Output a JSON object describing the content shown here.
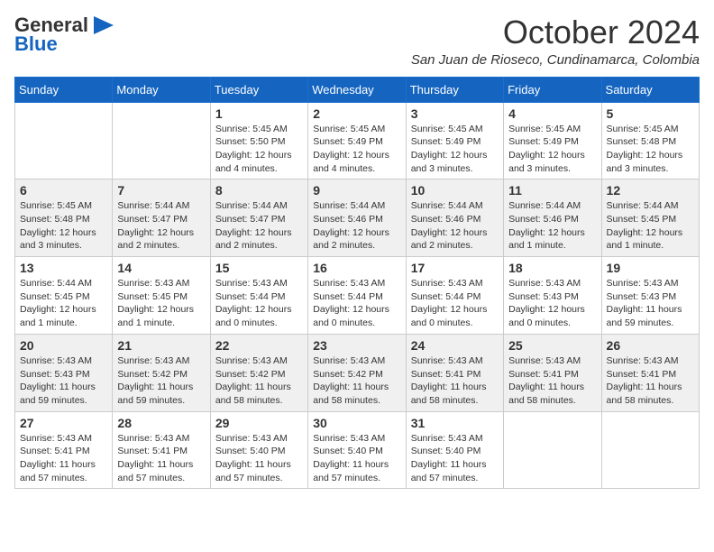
{
  "header": {
    "logo_general": "General",
    "logo_blue": "Blue",
    "month_title": "October 2024",
    "location": "San Juan de Rioseco, Cundinamarca, Colombia"
  },
  "days_of_week": [
    "Sunday",
    "Monday",
    "Tuesday",
    "Wednesday",
    "Thursday",
    "Friday",
    "Saturday"
  ],
  "weeks": [
    [
      {
        "day": "",
        "info": ""
      },
      {
        "day": "",
        "info": ""
      },
      {
        "day": "1",
        "info": "Sunrise: 5:45 AM\nSunset: 5:50 PM\nDaylight: 12 hours and 4 minutes."
      },
      {
        "day": "2",
        "info": "Sunrise: 5:45 AM\nSunset: 5:49 PM\nDaylight: 12 hours and 4 minutes."
      },
      {
        "day": "3",
        "info": "Sunrise: 5:45 AM\nSunset: 5:49 PM\nDaylight: 12 hours and 3 minutes."
      },
      {
        "day": "4",
        "info": "Sunrise: 5:45 AM\nSunset: 5:49 PM\nDaylight: 12 hours and 3 minutes."
      },
      {
        "day": "5",
        "info": "Sunrise: 5:45 AM\nSunset: 5:48 PM\nDaylight: 12 hours and 3 minutes."
      }
    ],
    [
      {
        "day": "6",
        "info": "Sunrise: 5:45 AM\nSunset: 5:48 PM\nDaylight: 12 hours and 3 minutes."
      },
      {
        "day": "7",
        "info": "Sunrise: 5:44 AM\nSunset: 5:47 PM\nDaylight: 12 hours and 2 minutes."
      },
      {
        "day": "8",
        "info": "Sunrise: 5:44 AM\nSunset: 5:47 PM\nDaylight: 12 hours and 2 minutes."
      },
      {
        "day": "9",
        "info": "Sunrise: 5:44 AM\nSunset: 5:46 PM\nDaylight: 12 hours and 2 minutes."
      },
      {
        "day": "10",
        "info": "Sunrise: 5:44 AM\nSunset: 5:46 PM\nDaylight: 12 hours and 2 minutes."
      },
      {
        "day": "11",
        "info": "Sunrise: 5:44 AM\nSunset: 5:46 PM\nDaylight: 12 hours and 1 minute."
      },
      {
        "day": "12",
        "info": "Sunrise: 5:44 AM\nSunset: 5:45 PM\nDaylight: 12 hours and 1 minute."
      }
    ],
    [
      {
        "day": "13",
        "info": "Sunrise: 5:44 AM\nSunset: 5:45 PM\nDaylight: 12 hours and 1 minute."
      },
      {
        "day": "14",
        "info": "Sunrise: 5:43 AM\nSunset: 5:45 PM\nDaylight: 12 hours and 1 minute."
      },
      {
        "day": "15",
        "info": "Sunrise: 5:43 AM\nSunset: 5:44 PM\nDaylight: 12 hours and 0 minutes."
      },
      {
        "day": "16",
        "info": "Sunrise: 5:43 AM\nSunset: 5:44 PM\nDaylight: 12 hours and 0 minutes."
      },
      {
        "day": "17",
        "info": "Sunrise: 5:43 AM\nSunset: 5:44 PM\nDaylight: 12 hours and 0 minutes."
      },
      {
        "day": "18",
        "info": "Sunrise: 5:43 AM\nSunset: 5:43 PM\nDaylight: 12 hours and 0 minutes."
      },
      {
        "day": "19",
        "info": "Sunrise: 5:43 AM\nSunset: 5:43 PM\nDaylight: 11 hours and 59 minutes."
      }
    ],
    [
      {
        "day": "20",
        "info": "Sunrise: 5:43 AM\nSunset: 5:43 PM\nDaylight: 11 hours and 59 minutes."
      },
      {
        "day": "21",
        "info": "Sunrise: 5:43 AM\nSunset: 5:42 PM\nDaylight: 11 hours and 59 minutes."
      },
      {
        "day": "22",
        "info": "Sunrise: 5:43 AM\nSunset: 5:42 PM\nDaylight: 11 hours and 58 minutes."
      },
      {
        "day": "23",
        "info": "Sunrise: 5:43 AM\nSunset: 5:42 PM\nDaylight: 11 hours and 58 minutes."
      },
      {
        "day": "24",
        "info": "Sunrise: 5:43 AM\nSunset: 5:41 PM\nDaylight: 11 hours and 58 minutes."
      },
      {
        "day": "25",
        "info": "Sunrise: 5:43 AM\nSunset: 5:41 PM\nDaylight: 11 hours and 58 minutes."
      },
      {
        "day": "26",
        "info": "Sunrise: 5:43 AM\nSunset: 5:41 PM\nDaylight: 11 hours and 58 minutes."
      }
    ],
    [
      {
        "day": "27",
        "info": "Sunrise: 5:43 AM\nSunset: 5:41 PM\nDaylight: 11 hours and 57 minutes."
      },
      {
        "day": "28",
        "info": "Sunrise: 5:43 AM\nSunset: 5:41 PM\nDaylight: 11 hours and 57 minutes."
      },
      {
        "day": "29",
        "info": "Sunrise: 5:43 AM\nSunset: 5:40 PM\nDaylight: 11 hours and 57 minutes."
      },
      {
        "day": "30",
        "info": "Sunrise: 5:43 AM\nSunset: 5:40 PM\nDaylight: 11 hours and 57 minutes."
      },
      {
        "day": "31",
        "info": "Sunrise: 5:43 AM\nSunset: 5:40 PM\nDaylight: 11 hours and 57 minutes."
      },
      {
        "day": "",
        "info": ""
      },
      {
        "day": "",
        "info": ""
      }
    ]
  ]
}
